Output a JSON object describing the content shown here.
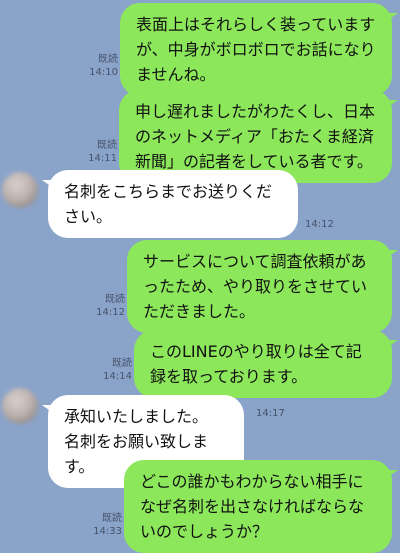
{
  "messages": [
    {
      "side": "out",
      "text": "表面上はそれらしく装っていますが、中身がボロボロでお話になりませんね。",
      "read": "既読",
      "time": "14:10"
    },
    {
      "side": "out",
      "text": "申し遅れましたがわたくし、日本のネットメディア「おたくま経済新聞」の記者をしている者です。",
      "read": "既読",
      "time": "14:11"
    },
    {
      "side": "in",
      "text": "名刺をこちらまでお送りください。",
      "time": "14:12"
    },
    {
      "side": "out",
      "text": "サービスについて調査依頼があったため、やり取りをさせていただきました。",
      "read": "既読",
      "time": "14:12"
    },
    {
      "side": "out",
      "text": "このLINEのやり取りは全て記録を取っております。",
      "read": "既読",
      "time": "14:14"
    },
    {
      "side": "in",
      "text": "承知いたしました。\n名刺をお願い致します。",
      "time": "14:17"
    },
    {
      "side": "out",
      "text": "どこの誰かもわからない相手になぜ名刺を出さなければならないのでしょうか？",
      "read": "既読",
      "time": "14:33"
    }
  ]
}
